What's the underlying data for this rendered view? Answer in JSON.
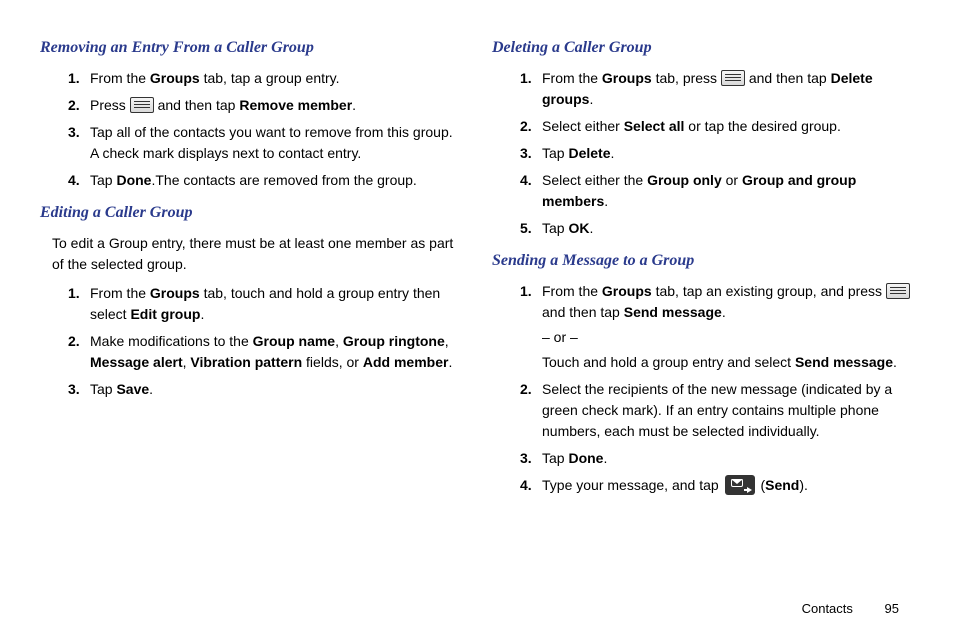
{
  "left": {
    "section1": {
      "heading": "Removing an Entry From a Caller Group",
      "steps": [
        [
          {
            "t": "From the "
          },
          {
            "b": "Groups"
          },
          {
            "t": " tab, tap a group entry."
          }
        ],
        [
          {
            "t": "Press "
          },
          {
            "icon": "menu"
          },
          {
            "t": " and then tap "
          },
          {
            "b": "Remove member"
          },
          {
            "t": "."
          }
        ],
        [
          {
            "t": "Tap all of the contacts you want to remove from this group. A check mark displays next to contact entry."
          }
        ],
        [
          {
            "t": "Tap "
          },
          {
            "b": "Done"
          },
          {
            "t": ".The contacts are removed from the group."
          }
        ]
      ]
    },
    "section2": {
      "heading": "Editing a Caller Group",
      "intro": "To edit a Group entry, there must be at least one member as part of the selected group.",
      "steps": [
        [
          {
            "t": "From the "
          },
          {
            "b": "Groups"
          },
          {
            "t": " tab, touch and hold a group entry then select "
          },
          {
            "b": "Edit group"
          },
          {
            "t": "."
          }
        ],
        [
          {
            "t": "Make modifications to the "
          },
          {
            "b": "Group name"
          },
          {
            "t": ", "
          },
          {
            "b": "Group ringtone"
          },
          {
            "t": ", "
          },
          {
            "b": "Message alert"
          },
          {
            "t": ", "
          },
          {
            "b": "Vibration pattern"
          },
          {
            "t": " fields, or "
          },
          {
            "b": "Add member"
          },
          {
            "t": "."
          }
        ],
        [
          {
            "t": "Tap "
          },
          {
            "b": "Save"
          },
          {
            "t": "."
          }
        ]
      ]
    }
  },
  "right": {
    "section1": {
      "heading": "Deleting a Caller Group",
      "steps": [
        [
          {
            "t": "From the "
          },
          {
            "b": "Groups"
          },
          {
            "t": " tab, press "
          },
          {
            "icon": "menu"
          },
          {
            "t": " and then tap "
          },
          {
            "b": "Delete groups"
          },
          {
            "t": "."
          }
        ],
        [
          {
            "t": "Select either "
          },
          {
            "b": "Select all"
          },
          {
            "t": " or tap the desired group."
          }
        ],
        [
          {
            "t": "Tap "
          },
          {
            "b": "Delete"
          },
          {
            "t": "."
          }
        ],
        [
          {
            "t": "Select either the "
          },
          {
            "b": "Group only"
          },
          {
            "t": " or "
          },
          {
            "b": "Group and group members"
          },
          {
            "t": "."
          }
        ],
        [
          {
            "t": "Tap "
          },
          {
            "b": "OK"
          },
          {
            "t": "."
          }
        ]
      ]
    },
    "section2": {
      "heading": "Sending a Message to a Group",
      "steps": [
        [
          {
            "t": "From the "
          },
          {
            "b": "Groups"
          },
          {
            "t": " tab, tap an existing group, and press "
          },
          {
            "icon": "menu"
          },
          {
            "t": " and then tap "
          },
          {
            "b": "Send message"
          },
          {
            "t": "."
          },
          {
            "sub": "– or –"
          },
          {
            "subrich": [
              {
                "t": "Touch and hold a group entry and select "
              },
              {
                "b": "Send message"
              },
              {
                "t": "."
              }
            ]
          }
        ],
        [
          {
            "t": "Select the recipients of the new message (indicated by a green check mark). If an entry contains multiple phone numbers, each must be selected individually."
          }
        ],
        [
          {
            "t": "Tap "
          },
          {
            "b": "Done"
          },
          {
            "t": "."
          }
        ],
        [
          {
            "t": "Type your message, and tap "
          },
          {
            "icon": "send"
          },
          {
            "t": " ("
          },
          {
            "b": "Send"
          },
          {
            "t": ")."
          }
        ]
      ]
    }
  },
  "footer": {
    "section": "Contacts",
    "page": "95"
  }
}
